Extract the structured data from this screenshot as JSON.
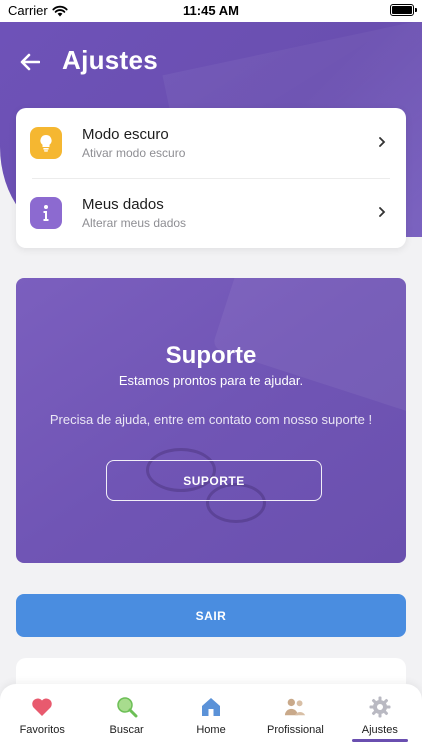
{
  "status_bar": {
    "carrier": "Carrier",
    "time": "11:45 AM"
  },
  "header": {
    "title": "Ajustes",
    "back_icon": "arrow-left-icon"
  },
  "settings": {
    "items": [
      {
        "title": "Modo escuro",
        "subtitle": "Ativar modo escuro",
        "icon": "lightbulb-icon",
        "icon_color": "#f5b731"
      },
      {
        "title": "Meus dados",
        "subtitle": "Alterar meus dados",
        "icon": "info-icon",
        "icon_color": "#8c6ad0"
      }
    ]
  },
  "support": {
    "title": "Suporte",
    "subtitle": "Estamos prontos para te ajudar.",
    "description": "Precisa de ajuda, entre em contato com nosso suporte !",
    "button_label": "SUPORTE"
  },
  "logout": {
    "label": "SAIR"
  },
  "tabs": [
    {
      "label": "Favoritos",
      "icon": "heart-icon",
      "active": false
    },
    {
      "label": "Buscar",
      "icon": "search-icon",
      "active": false
    },
    {
      "label": "Home",
      "icon": "home-icon",
      "active": false
    },
    {
      "label": "Profissional",
      "icon": "people-icon",
      "active": false
    },
    {
      "label": "Ajustes",
      "icon": "gear-icon",
      "active": true
    }
  ],
  "colors": {
    "primary": "#6a4fb0",
    "logout_button": "#4a8de0",
    "background": "#f2f2f4"
  }
}
